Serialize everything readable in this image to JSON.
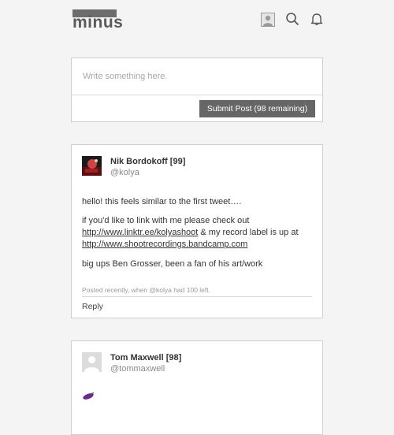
{
  "header": {
    "logo_text": "minus",
    "icons": [
      "user-avatar-icon",
      "search-icon",
      "bell-icon"
    ]
  },
  "compose": {
    "placeholder": "Write something here.",
    "submit_label": "Submit Post (98 remaining)"
  },
  "posts": [
    {
      "name": "Nik Bordokoff",
      "score": "[99]",
      "handle": "@kolya",
      "line1": "hello! this feels similar to the first tweet….",
      "line2": "if you'd like to link with me please check out",
      "link1": "http://www.linktr.ee/kolyashoot",
      "line3_rest": " & my record label is up at",
      "link2": "http://www.shootrecordings.bandcamp.com",
      "line4": "big ups Ben Grosser, been a fan of his art/work",
      "meta": "Posted recently, when @kolya had 100 left.",
      "reply_label": "Reply"
    },
    {
      "name": "Tom Maxwell",
      "score": "[98]",
      "handle": "@tommaxwell",
      "emoji_icon": "eggplant-icon"
    }
  ],
  "colors": {
    "background": "#f4f4f4",
    "submit_button": "#666666",
    "logo": "#5a5a5a"
  }
}
